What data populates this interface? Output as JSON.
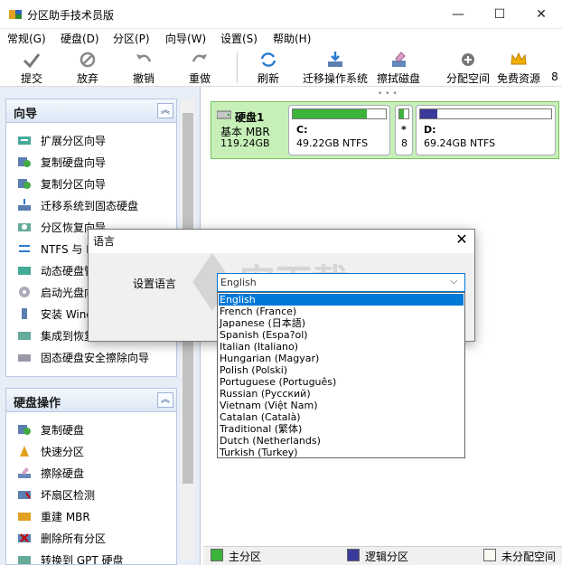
{
  "window": {
    "title": "分区助手技术员版",
    "minimize": "—",
    "maximize": "☐",
    "close": "✕"
  },
  "menu": [
    "常规(G)",
    "硬盘(D)",
    "分区(P)",
    "向导(W)",
    "设置(S)",
    "帮助(H)"
  ],
  "toolbar": {
    "commit": "提交",
    "discard": "放弃",
    "undo": "撤销",
    "redo": "重做",
    "refresh": "刷新",
    "migrate_os": "迁移操作系统",
    "wipe_disk": "擦拭磁盘",
    "allocate_space": "分配空间",
    "free_resources": "免费资源",
    "more": "8"
  },
  "wizard_panel": {
    "title": "向导",
    "items": [
      "扩展分区向导",
      "复制硬盘向导",
      "复制分区向导",
      "迁移系统到固态硬盘",
      "分区恢复向导",
      "NTFS 与 FAT32 转换",
      "动态硬盘管理",
      "启动光盘向导",
      "安装 Windows To Go",
      "集成到恢复环境",
      "固态硬盘安全擦除向导"
    ]
  },
  "disk_ops_panel": {
    "title": "硬盘操作",
    "items": [
      "复制硬盘",
      "快速分区",
      "擦除硬盘",
      "坏扇区检测",
      "重建 MBR",
      "删除所有分区",
      "转换到 GPT 硬盘"
    ]
  },
  "disk": {
    "name": "硬盘1",
    "type": "基本 MBR",
    "size": "119.24GB",
    "partitions": [
      {
        "label": "C:",
        "detail": "49.22GB NTFS",
        "fill": 0.8,
        "color": "#3cb43c"
      },
      {
        "label": "*",
        "detail": "8",
        "fill": 0.5,
        "color": "#3cb43c"
      },
      {
        "label": "D:",
        "detail": "69.24GB NTFS",
        "fill": 0.13,
        "color": "#3a3a9a"
      }
    ]
  },
  "legend": {
    "primary": "主分区",
    "logical": "逻辑分区",
    "unallocated": "未分配空间",
    "primary_color": "#3cb43c",
    "logical_color": "#3a3a9a",
    "unallocated_color": "#fafaf0"
  },
  "dialog": {
    "title": "语言",
    "close": "✕",
    "label": "设置语言",
    "selected": "English",
    "options": [
      "English",
      "French (France)",
      "Japanese (日本語)",
      "Spanish (Espa?ol)",
      "Italian (Italiano)",
      "Hungarian (Magyar)",
      "Polish (Polski)",
      "Portuguese (Português)",
      "Russian (Русский)",
      "Vietnam (Việt Nam)",
      "Catalan (Català)",
      "Traditional (繁体)",
      "Dutch (Netherlands)",
      "Turkish (Turkey)"
    ]
  },
  "watermark": "安下载"
}
